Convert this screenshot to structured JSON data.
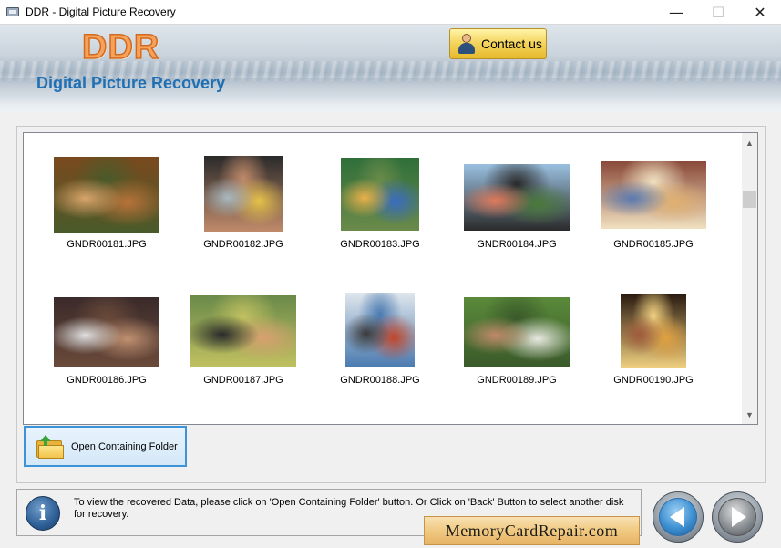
{
  "window": {
    "title": "DDR - Digital Picture Recovery",
    "controls": {
      "minimize": "—",
      "maximize": "☐",
      "close": "✕"
    }
  },
  "header": {
    "logo_text": "DDR",
    "subtitle": "Digital Picture Recovery",
    "contact_label": "Contact us"
  },
  "gallery": {
    "items": [
      {
        "label": "GNDR00181.JPG",
        "palette": [
          "#7a4a1e",
          "#b8733a",
          "#d9a56b",
          "#4a5a2a"
        ]
      },
      {
        "label": "GNDR00182.JPG",
        "palette": [
          "#2a2a2a",
          "#e6c24a",
          "#a8b8c0",
          "#c08a6a"
        ]
      },
      {
        "label": "GNDR00183.JPG",
        "palette": [
          "#2f6f3a",
          "#3a6cc0",
          "#e8b04a",
          "#6a8a4a"
        ]
      },
      {
        "label": "GNDR00184.JPG",
        "palette": [
          "#9ac0e0",
          "#4a7a3a",
          "#e07a5a",
          "#2a2a2a"
        ]
      },
      {
        "label": "GNDR00185.JPG",
        "palette": [
          "#8a4a3a",
          "#e0b070",
          "#5a7ab0",
          "#f0e0c0"
        ]
      },
      {
        "label": "GNDR00186.JPG",
        "palette": [
          "#3a2a2a",
          "#c09070",
          "#e0e0e0",
          "#6a4a3a"
        ]
      },
      {
        "label": "GNDR00187.JPG",
        "palette": [
          "#6a8a4a",
          "#d8a070",
          "#2a2a2a",
          "#c0c060"
        ]
      },
      {
        "label": "GNDR00188.JPG",
        "palette": [
          "#dfe6ec",
          "#c0452a",
          "#3a3a3a",
          "#4a7ab0"
        ]
      },
      {
        "label": "GNDR00189.JPG",
        "palette": [
          "#5a8a3a",
          "#e8e8e0",
          "#c08a6a",
          "#3a5a2a"
        ]
      },
      {
        "label": "GNDR00190.JPG",
        "palette": [
          "#2a1a10",
          "#e0a040",
          "#a05a3a",
          "#f0d080"
        ]
      }
    ]
  },
  "actions": {
    "open_folder_label": "Open Containing Folder"
  },
  "info": {
    "message": "To view the recovered Data, please click on 'Open Containing Folder' button. Or Click on 'Back' Button to select another disk for recovery."
  },
  "footer": {
    "site": "MemoryCardRepair.com"
  }
}
